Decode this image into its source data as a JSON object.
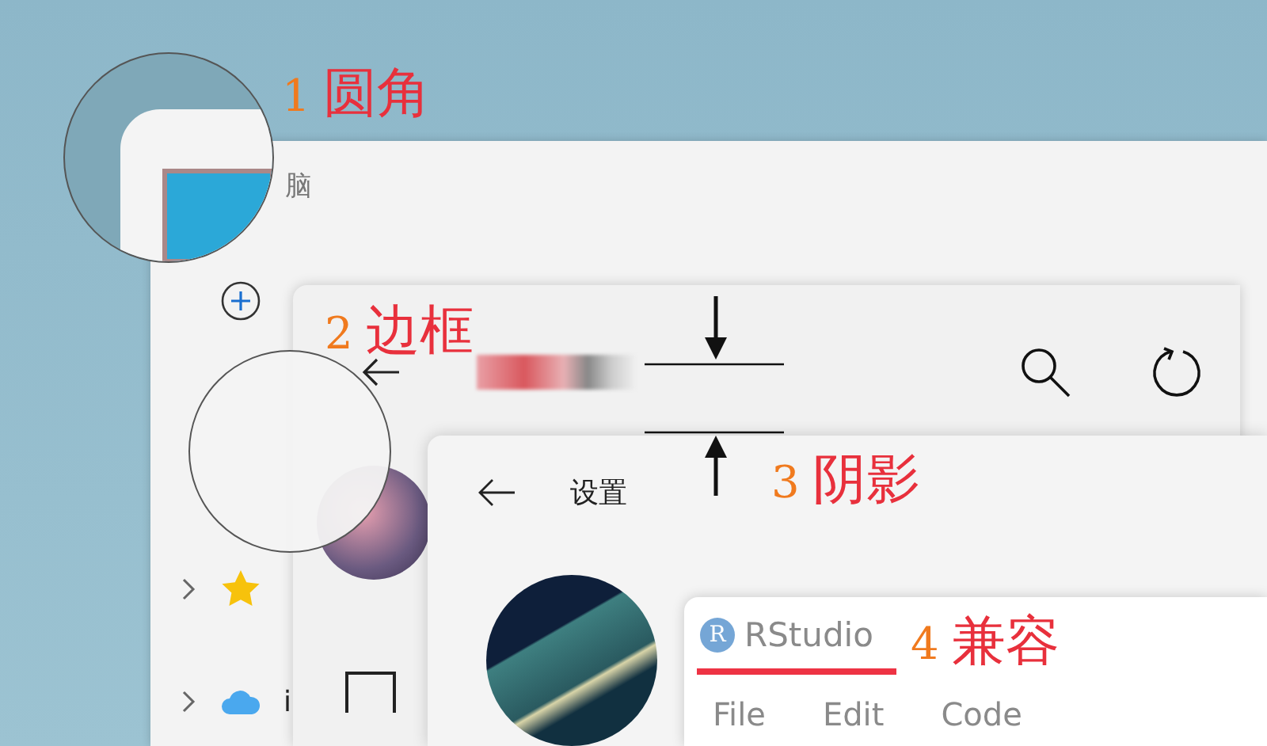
{
  "annotations": [
    {
      "number": "1",
      "label": "圆角"
    },
    {
      "number": "2",
      "label": "边框"
    },
    {
      "number": "3",
      "label": "阴影"
    },
    {
      "number": "4",
      "label": "兼容"
    }
  ],
  "explorer": {
    "title": "脑",
    "sidebar": {
      "items": [
        {
          "kind": "star",
          "expanded": false
        },
        {
          "kind": "cloud",
          "label": "i",
          "expanded": false
        }
      ]
    }
  },
  "settings": {
    "title": "设置"
  },
  "rstudio": {
    "title": "RStudio",
    "logo": "R",
    "menu": [
      "File",
      "Edit",
      "Code"
    ]
  }
}
